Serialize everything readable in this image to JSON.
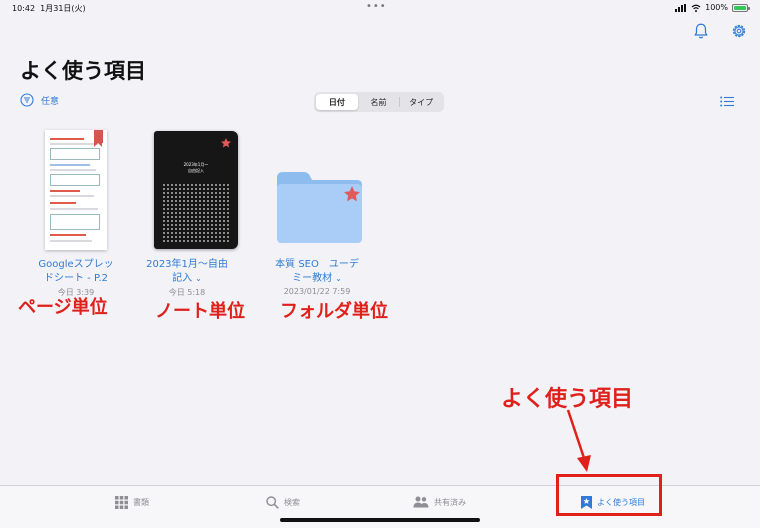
{
  "status": {
    "time": "10:42",
    "date": "1月31日(火)",
    "dots": "•••",
    "battery": "100%"
  },
  "header": {
    "title": "よく使う項目"
  },
  "toolbar": {
    "filter_label": "任意",
    "sort_tabs": [
      "日付",
      "名前",
      "タイプ"
    ],
    "active_sort": "日付"
  },
  "items": [
    {
      "name_line1": "Googleスプレッ",
      "name_line2": "ドシート - P.2",
      "date": "今日 3:39",
      "kind": "page"
    },
    {
      "name_line1": "2023年1月〜自由",
      "name_line2": "記入",
      "date": "今日 5:18",
      "kind": "notebook",
      "cover_line1": "2023年1月〜",
      "cover_line2": "自由記入"
    },
    {
      "name_line1": "本質 SEO　ユーデ",
      "name_line2": "ミー教材",
      "date": "2023/01/22 7:59",
      "kind": "folder"
    }
  ],
  "annotations": {
    "page_unit": "ページ単位",
    "note_unit": "ノート単位",
    "folder_unit": "フォルダ単位",
    "favorites_callout": "よく使う項目"
  },
  "tabbar": {
    "tabs": [
      "書類",
      "検索",
      "共有済み",
      "よく使う項目"
    ],
    "active": "よく使う項目"
  },
  "colors": {
    "accent": "#2f7bd6",
    "annotation": "#e0201a",
    "star": "#e05a5a",
    "folder": "#a9cdf7"
  }
}
